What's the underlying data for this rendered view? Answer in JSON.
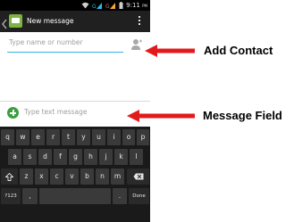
{
  "status_bar": {
    "time": "9:11",
    "ampm": "PM",
    "icons": [
      "wifi-icon",
      "signal-icon",
      "signal-icon",
      "battery-icon"
    ]
  },
  "action_bar": {
    "title": "New message",
    "icons": [
      "back-icon",
      "messaging-app-icon",
      "overflow-menu-icon"
    ]
  },
  "compose": {
    "to_placeholder": "Type name or number",
    "message_placeholder": "Type text message",
    "icons": [
      "add-contact-icon",
      "attach-icon"
    ]
  },
  "keyboard": {
    "row1": [
      "q",
      "w",
      "e",
      "r",
      "t",
      "y",
      "u",
      "i",
      "o",
      "p"
    ],
    "row2": [
      "a",
      "s",
      "d",
      "f",
      "g",
      "h",
      "j",
      "k",
      "l"
    ],
    "row3": [
      "z",
      "x",
      "c",
      "v",
      "b",
      "n",
      "m"
    ],
    "shift_icon": "shift-icon",
    "delete_icon": "backspace-icon",
    "symbols_label": "?123",
    "comma_label": ",",
    "period_label": ".",
    "done_label": "Done"
  },
  "annotations": {
    "add_contact": "Add Contact",
    "message_field": "Message Field"
  },
  "colors": {
    "accent_blue": "#33b5e5",
    "arrow_red": "#e31a1c",
    "attach_green": "#3d9e40",
    "app_icon_green": "#7cb342"
  }
}
